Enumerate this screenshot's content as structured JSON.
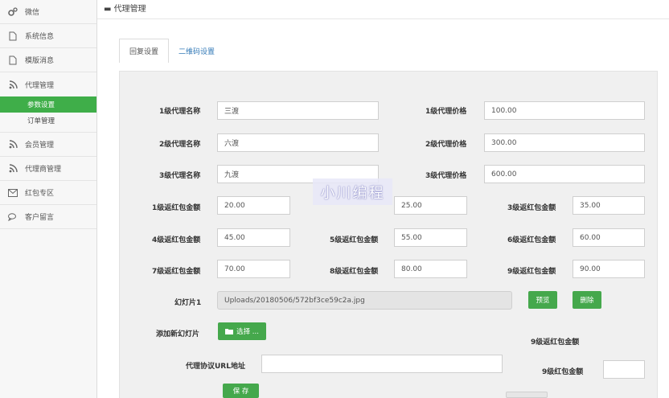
{
  "sidebar": {
    "items": [
      {
        "label": "微信",
        "icon": "gears-icon"
      },
      {
        "label": "系统信息",
        "icon": "file-icon"
      },
      {
        "label": "模版消息",
        "icon": "file-icon"
      },
      {
        "label": "代理管理",
        "icon": "rss-icon"
      },
      {
        "label": "会员管理",
        "icon": "rss-icon"
      },
      {
        "label": "代理商管理",
        "icon": "rss-icon"
      },
      {
        "label": "红包专区",
        "icon": "mail-icon"
      },
      {
        "label": "客户留言",
        "icon": "comments-icon"
      }
    ],
    "subitems": [
      {
        "label": "参数设置",
        "active": true
      },
      {
        "label": "订单管理",
        "active": false
      }
    ]
  },
  "header": {
    "title": "▬ 代理管理"
  },
  "tabs": [
    {
      "label": "回复设置",
      "active": true
    },
    {
      "label": "二维码设置",
      "active": false
    }
  ],
  "form": {
    "agent_names": [
      {
        "label": "1级代理名称",
        "value": "三渡"
      },
      {
        "label": "2级代理名称",
        "value": "六渡"
      },
      {
        "label": "3级代理名称",
        "value": "九渡"
      }
    ],
    "agent_prices": [
      {
        "label": "1级代理价格",
        "value": "100.00"
      },
      {
        "label": "2级代理价格",
        "value": "300.00"
      },
      {
        "label": "3级代理价格",
        "value": "600.00"
      }
    ],
    "redpacks": [
      {
        "label": "1级返红包金额",
        "value": "20.00"
      },
      {
        "label": "",
        "value": "25.00"
      },
      {
        "label": "3级返红包金额",
        "value": "35.00"
      },
      {
        "label": "4级返红包金额",
        "value": "45.00"
      },
      {
        "label": "5级返红包金额",
        "value": "55.00"
      },
      {
        "label": "6级返红包金额",
        "value": "60.00"
      },
      {
        "label": "7级返红包金额",
        "value": "70.00"
      },
      {
        "label": "8级返红包金额",
        "value": "80.00"
      },
      {
        "label": "9级返红包金额",
        "value": "90.00"
      }
    ],
    "slide": {
      "label": "幻灯片1",
      "path": "Uploads/20180506/572bf3ce59c2a.jpg",
      "preview": "预览",
      "delete": "删除"
    },
    "add_slide": {
      "label": "添加新幻灯片",
      "button": "选择 ..."
    },
    "right_label_a": "9级返红包金额",
    "right_label_b": "9级红包金额",
    "url": {
      "label": "代理协议URL地址",
      "value": ""
    },
    "save": "保 存"
  },
  "watermark": "小川编程",
  "colors": {
    "accent": "#3fae49",
    "link": "#337ab7"
  }
}
